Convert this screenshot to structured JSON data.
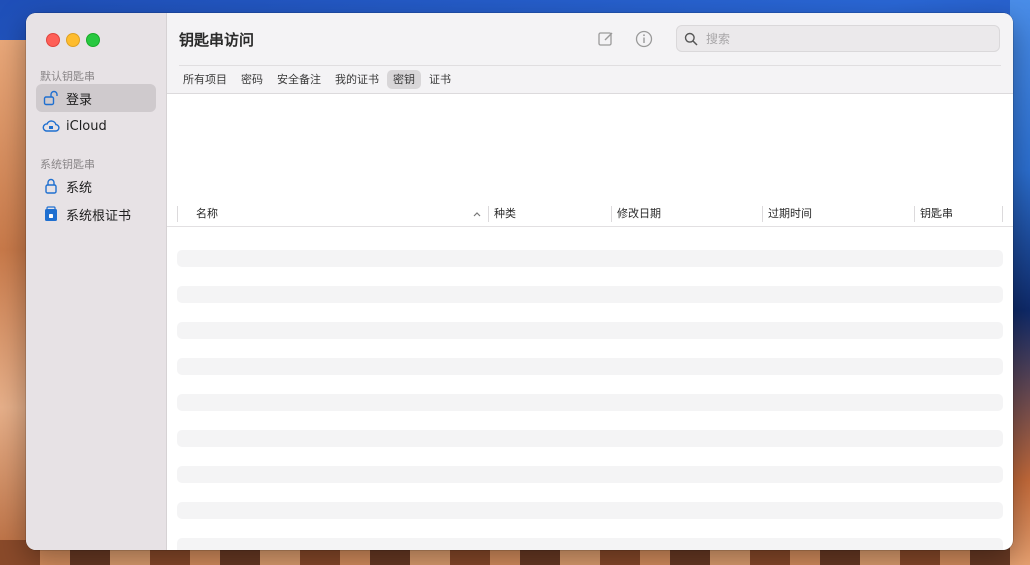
{
  "window": {
    "title": "钥匙串访问"
  },
  "sidebar": {
    "sections": [
      {
        "label": "默认钥匙串",
        "items": [
          {
            "label": "登录",
            "icon": "unlocked-padlock-icon",
            "selected": true
          },
          {
            "label": "iCloud",
            "icon": "cloud-icon",
            "selected": false
          }
        ]
      },
      {
        "label": "系统钥匙串",
        "items": [
          {
            "label": "系统",
            "icon": "padlock-icon",
            "selected": false
          },
          {
            "label": "系统根证书",
            "icon": "locked-cabinet-icon",
            "selected": false
          }
        ]
      }
    ]
  },
  "toolbar": {
    "search_placeholder": "搜索",
    "icons": [
      "compose-icon",
      "info-icon",
      "search-icon"
    ]
  },
  "tabs": [
    {
      "label": "所有项目",
      "active": false
    },
    {
      "label": "密码",
      "active": false
    },
    {
      "label": "安全备注",
      "active": false
    },
    {
      "label": "我的证书",
      "active": false
    },
    {
      "label": "密钥",
      "active": true
    },
    {
      "label": "证书",
      "active": false
    }
  ],
  "table": {
    "columns": [
      "名称",
      "种类",
      "修改日期",
      "过期时间",
      "钥匙串"
    ],
    "sort_column": "名称",
    "sort_direction": "ascending",
    "rows": []
  },
  "colors": {
    "accent": "#1f6fd0",
    "close": "#fe5f57",
    "minimize": "#febc2e",
    "maximize": "#28c840"
  }
}
